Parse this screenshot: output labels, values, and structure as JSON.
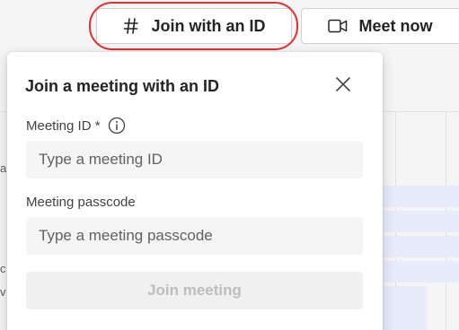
{
  "toolbar": {
    "join_with_id_label": "Join with an ID",
    "meet_now_label": "Meet now",
    "join_icon": "hash-icon",
    "meet_icon": "video-camera-icon"
  },
  "dialog": {
    "title": "Join a meeting with an ID",
    "close_icon": "close-icon",
    "meeting_id": {
      "label": "Meeting ID *",
      "placeholder": "Type a meeting ID",
      "value": "",
      "info_icon": "info-icon"
    },
    "meeting_passcode": {
      "label": "Meeting passcode",
      "placeholder": "Type a meeting passcode",
      "value": ""
    },
    "join_button": {
      "label": "Join meeting",
      "enabled": false
    }
  },
  "background": {
    "edge_chars": [
      "a",
      "c",
      "v"
    ]
  },
  "colors": {
    "highlight_ring": "#e0302f",
    "event_fill": "#e8ebfa",
    "disabled_text": "#bdbdbd"
  }
}
